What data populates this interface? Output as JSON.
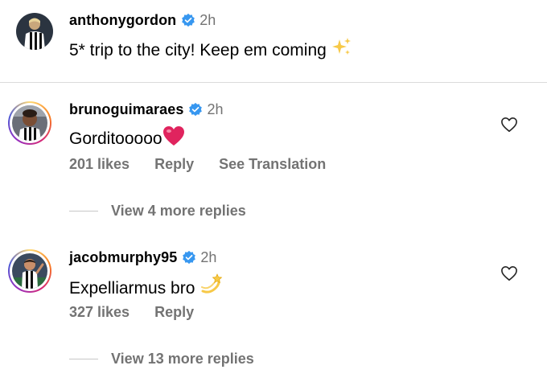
{
  "caption": {
    "username": "anthonygordon",
    "time": "2h",
    "text": "5* trip to the city! Keep em coming",
    "emoji_icon": "sparkles-icon"
  },
  "comments": [
    {
      "username": "brunoguimaraes",
      "time": "2h",
      "text": "Gorditooooo",
      "emoji_icon": "red-heart-icon",
      "likes": "201 likes",
      "reply_label": "Reply",
      "translate_label": "See Translation",
      "view_replies": "View 4 more replies"
    },
    {
      "username": "jacobmurphy95",
      "time": "2h",
      "text": "Expelliarmus bro",
      "emoji_icon": "dizzy-icon",
      "likes": "327 likes",
      "reply_label": "Reply",
      "view_replies": "View 13 more replies"
    }
  ],
  "colors": {
    "verified": "#3797f0",
    "secondary_text": "#737373",
    "heart_red": "#e0245e",
    "story_ring": "#d62976"
  }
}
